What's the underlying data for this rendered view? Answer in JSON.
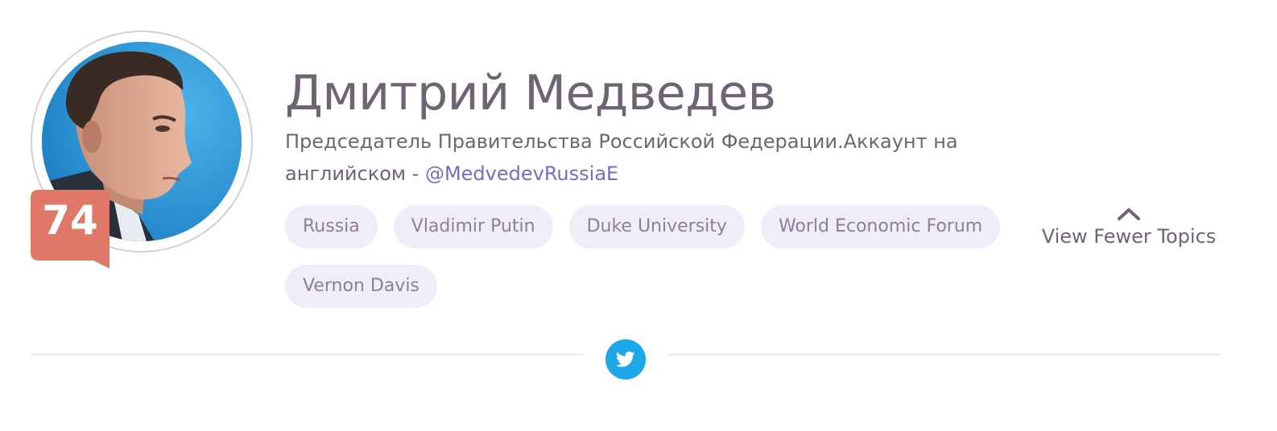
{
  "profile": {
    "name": "Дмитрий Медведев",
    "bio_text": "Председатель Правительства Российской Федерации.Аккаунт на английском - ",
    "bio_link": "@MedvedevRussiaE",
    "score": "74",
    "avatar_icon": "person-photo",
    "colors": {
      "name_text": "#6f6473",
      "link": "#6d6fc3",
      "badge": "#e0786a",
      "chip_bg": "#efeef8",
      "twitter": "#1ea7e8"
    }
  },
  "topics": {
    "items": [
      {
        "label": "Russia"
      },
      {
        "label": "Vladimir Putin"
      },
      {
        "label": "Duke University"
      },
      {
        "label": "World Economic Forum"
      },
      {
        "label": "Vernon Davis"
      }
    ],
    "toggle_label": "View Fewer Topics",
    "toggle_icon": "chevron-up-icon"
  },
  "footer": {
    "social_icon": "twitter-icon"
  }
}
